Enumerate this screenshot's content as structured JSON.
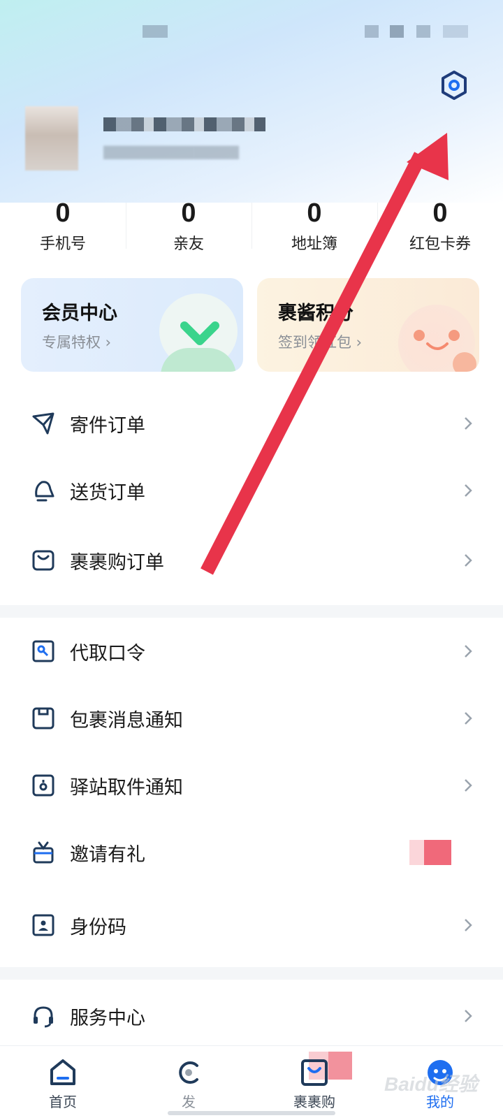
{
  "stats": [
    {
      "value": "0",
      "label": "手机号"
    },
    {
      "value": "0",
      "label": "亲友"
    },
    {
      "value": "0",
      "label": "地址簿"
    },
    {
      "value": "0",
      "label": "红包卡券"
    }
  ],
  "cards": {
    "vip": {
      "title": "会员中心",
      "subtitle": "专属特权 ›"
    },
    "points": {
      "title": "裹酱积分",
      "subtitle": "签到领红包 ›"
    }
  },
  "menu_group_1": [
    {
      "label": "寄件订单",
      "icon": "paper-plane-icon"
    },
    {
      "label": "送货订单",
      "icon": "bell-icon"
    },
    {
      "label": "裹裹购订单",
      "icon": "shopping-bag-icon"
    }
  ],
  "menu_group_2": [
    {
      "label": "代取口令",
      "icon": "key-card-icon"
    },
    {
      "label": "包裹消息通知",
      "icon": "package-message-icon"
    },
    {
      "label": "驿站取件通知",
      "icon": "station-notice-icon"
    },
    {
      "label": "邀请有礼",
      "icon": "gift-icon"
    },
    {
      "label": "身份码",
      "icon": "id-code-icon"
    }
  ],
  "menu_group_3": [
    {
      "label": "服务中心",
      "icon": "headset-icon"
    }
  ],
  "tabs": [
    {
      "label": "首页",
      "icon": "home-icon"
    },
    {
      "label": "发",
      "icon": "send-icon"
    },
    {
      "label": "裹裹购",
      "icon": "shop-icon"
    },
    {
      "label": "我的",
      "icon": "profile-icon"
    }
  ],
  "watermark": "Baidu经验",
  "colors": {
    "accent": "#1e6ef0",
    "arrow": "#e8344a",
    "icon_dark": "#1f3a5a"
  }
}
